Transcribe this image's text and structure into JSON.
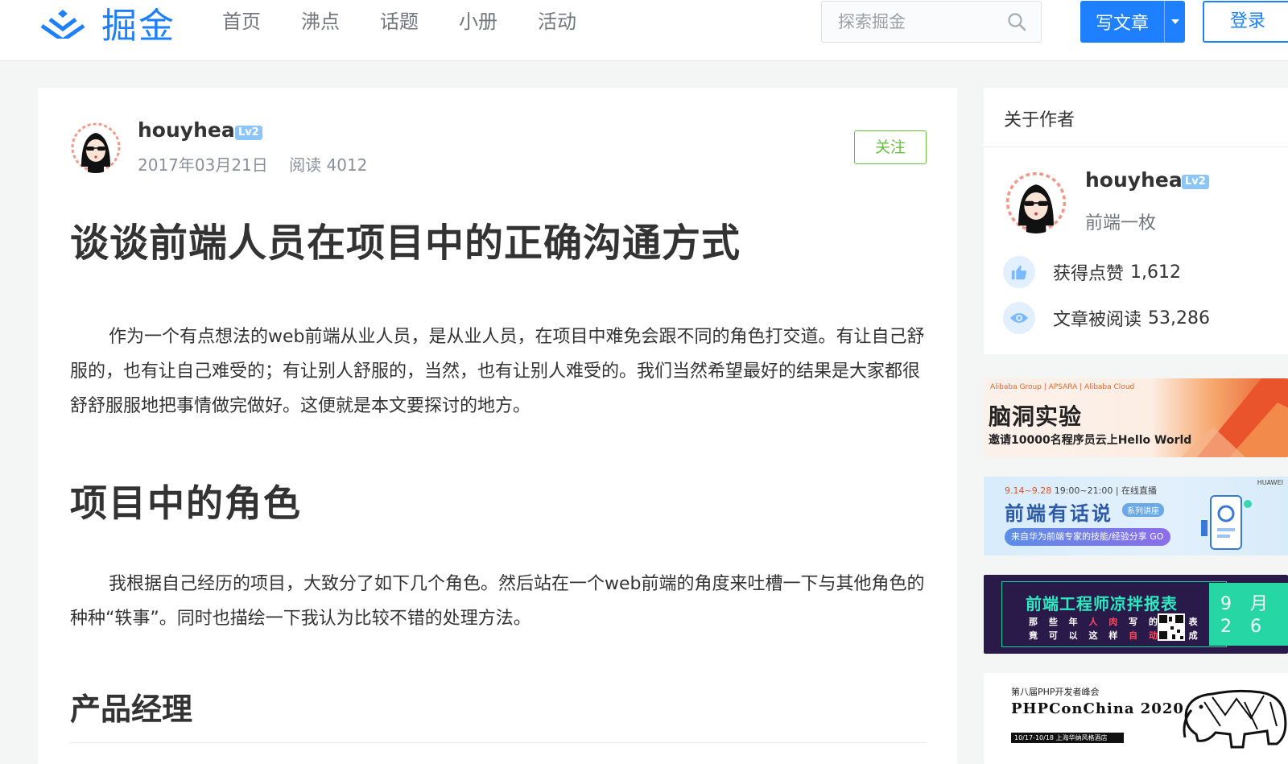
{
  "header": {
    "logo_text": "掘金",
    "nav": [
      "首页",
      "沸点",
      "话题",
      "小册",
      "活动"
    ],
    "search_placeholder": "探索掘金",
    "write_label": "写文章",
    "login_label": "登录"
  },
  "article": {
    "author": "houyhea",
    "level": "Lv2",
    "date": "2017年03月21日",
    "reads": "阅读 4012",
    "follow_label": "关注",
    "title": "谈谈前端人员在项目中的正确沟通方式",
    "para1": "作为一个有点想法的web前端从业人员，是从业人员，在项目中难免会跟不同的角色打交道。有让自己舒服的，也有让自己难受的；有让别人舒服的，当然，也有让别人难受的。我们当然希望最好的结果是大家都很舒舒服服地把事情做完做好。这便就是本文要探讨的地方。",
    "heading2": "项目中的角色",
    "para2": "我根据自己经历的项目，大致分了如下几个角色。然后站在一个web前端的角度来吐槽一下与其他角色的种种“轶事”。同时也描绘一下我认为比较不错的处理方法。",
    "heading3": "产品经理"
  },
  "sidebar": {
    "about_title": "关于作者",
    "author": "houyhea",
    "level": "Lv2",
    "bio": "前端一枚",
    "likes_label": "获得点赞",
    "likes": "1,612",
    "reads_label": "文章被阅读",
    "reads": "53,286"
  },
  "ads": {
    "ad1": {
      "top": "Alibaba Group | APSARA | Alibaba Cloud",
      "title": "脑洞实验",
      "sub": "邀请10000名程序员云上Hello World"
    },
    "ad2": {
      "date_hl": "9.14~9.28",
      "date_rest": " 19:00~21:00 | 在线直播",
      "title": "前端有话说",
      "tag": "系列讲座",
      "pill": "来自华为前端专家的技能/经验分享 GO",
      "brand": "HUAWEI"
    },
    "ad3": {
      "title": "前端工程师凉拌报表",
      "line1_a": "那 些 年 ",
      "line1_b": "人 肉",
      "line1_c": " 写 的 报 表",
      "line2_a": "竟 可 以 这 样 ",
      "line2_b": "自 动",
      "line2_c": " 生 成",
      "cal_top": "9 月",
      "cal_bot": "2 6"
    },
    "ad4": {
      "top": "第八届PHP开发者峰会",
      "title": "PHPConChina 2020",
      "bar": "10/17-10/18 上海华纳风格酒店"
    }
  },
  "colors": {
    "brand": "#1e80ff",
    "follow_green": "#6cbd45",
    "background": "#f4f5f5"
  }
}
